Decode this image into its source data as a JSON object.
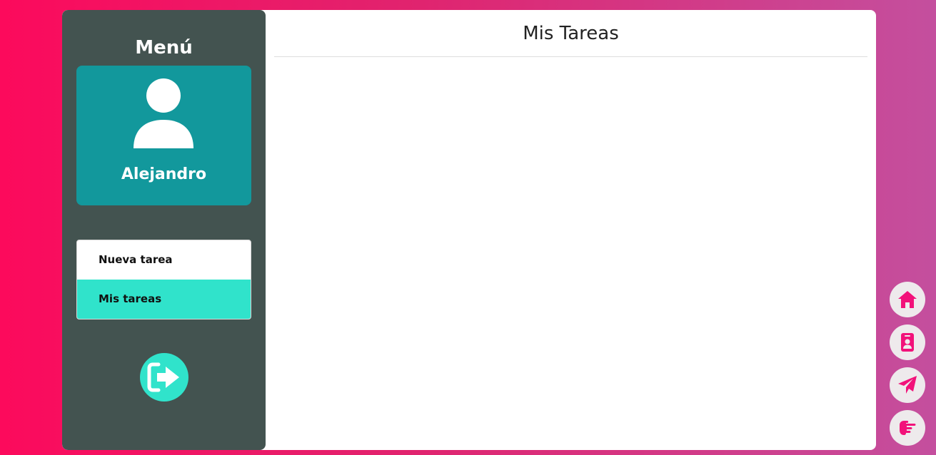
{
  "sidebar": {
    "title": "Menú",
    "user": {
      "name": "Alejandro",
      "avatar_icon": "user-icon"
    },
    "nav": [
      {
        "label": "Nueva tarea",
        "active": false
      },
      {
        "label": "Mis tareas",
        "active": true
      }
    ],
    "logout_icon": "sign-out-icon"
  },
  "main": {
    "title": "Mis Tareas"
  },
  "floating_nav": [
    {
      "icon": "home-icon"
    },
    {
      "icon": "contact-card-icon"
    },
    {
      "icon": "paper-plane-icon"
    },
    {
      "icon": "hand-pointing-icon"
    }
  ],
  "colors": {
    "background_start": "#fc0a5c",
    "background_end": "#c44f9e",
    "sidebar": "#435350",
    "user_card": "#12989c",
    "accent": "#30e3cb",
    "fab_icon": "#f2127a"
  }
}
